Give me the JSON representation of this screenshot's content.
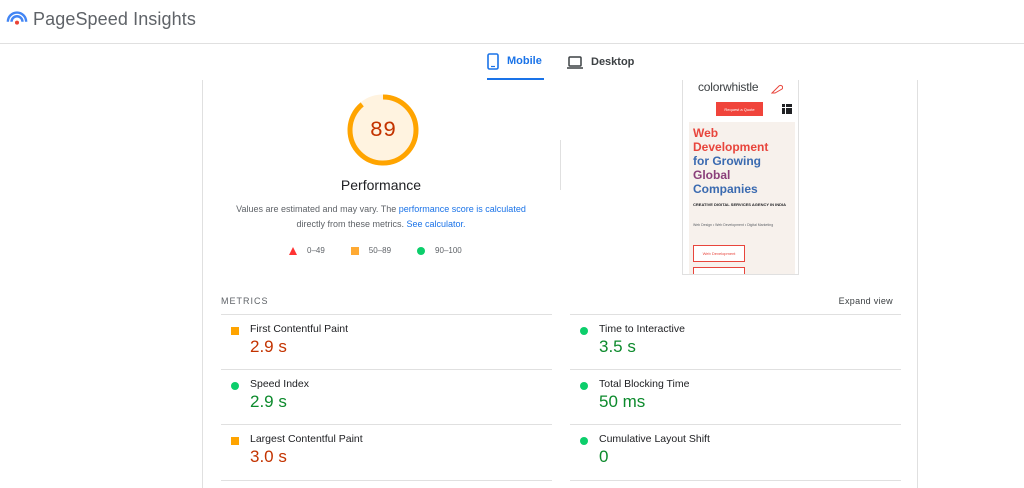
{
  "app": {
    "title": "PageSpeed Insights",
    "logo_icon": "pagespeed-logo-icon"
  },
  "tabs": [
    {
      "label": "Mobile",
      "icon": "phone-icon",
      "active": true
    },
    {
      "label": "Desktop",
      "icon": "laptop-icon",
      "active": false
    }
  ],
  "performance": {
    "score": "89",
    "score_value": 0.89,
    "title": "Performance",
    "note_prefix": "Values are estimated and may vary. The ",
    "note_link1": "performance score is calculated",
    "note_middle": " directly from these metrics. ",
    "note_link2": "See calculator."
  },
  "legend": [
    {
      "range": "0–49",
      "shape": "triangle",
      "color": "#ff3333"
    },
    {
      "range": "50–89",
      "shape": "square",
      "color": "#ffaa33"
    },
    {
      "range": "90–100",
      "shape": "circle",
      "color": "#0cce6b"
    }
  ],
  "screenshot": {
    "brand": "colorwhistle",
    "quote_button": "Request a Quote",
    "hero_line1": "Web",
    "hero_line2": "Development",
    "hero_line3": "for Growing",
    "hero_line4": "Global",
    "hero_line5": "Companies",
    "subtitle": "CREATIVE DIGITAL SERVICES AGENCY IN INDIA",
    "crumbs": "Web Design • Web Development • Digital Marketing",
    "cta": "Web Development"
  },
  "metrics": {
    "label": "METRICS",
    "expand_label": "Expand view",
    "items": [
      {
        "title": "First Contentful Paint",
        "value": "2.9 s",
        "status": "average"
      },
      {
        "title": "Time to Interactive",
        "value": "3.5 s",
        "status": "pass"
      },
      {
        "title": "Speed Index",
        "value": "2.9 s",
        "status": "pass"
      },
      {
        "title": "Total Blocking Time",
        "value": "50 ms",
        "status": "pass"
      },
      {
        "title": "Largest Contentful Paint",
        "value": "3.0 s",
        "status": "average"
      },
      {
        "title": "Cumulative Layout Shift",
        "value": "0",
        "status": "pass"
      }
    ]
  },
  "colors": {
    "accent": "#1a73e8",
    "average": "#ffa400",
    "pass": "#0cce6b",
    "average_text": "#c33300",
    "pass_text": "#0c8a2c"
  }
}
